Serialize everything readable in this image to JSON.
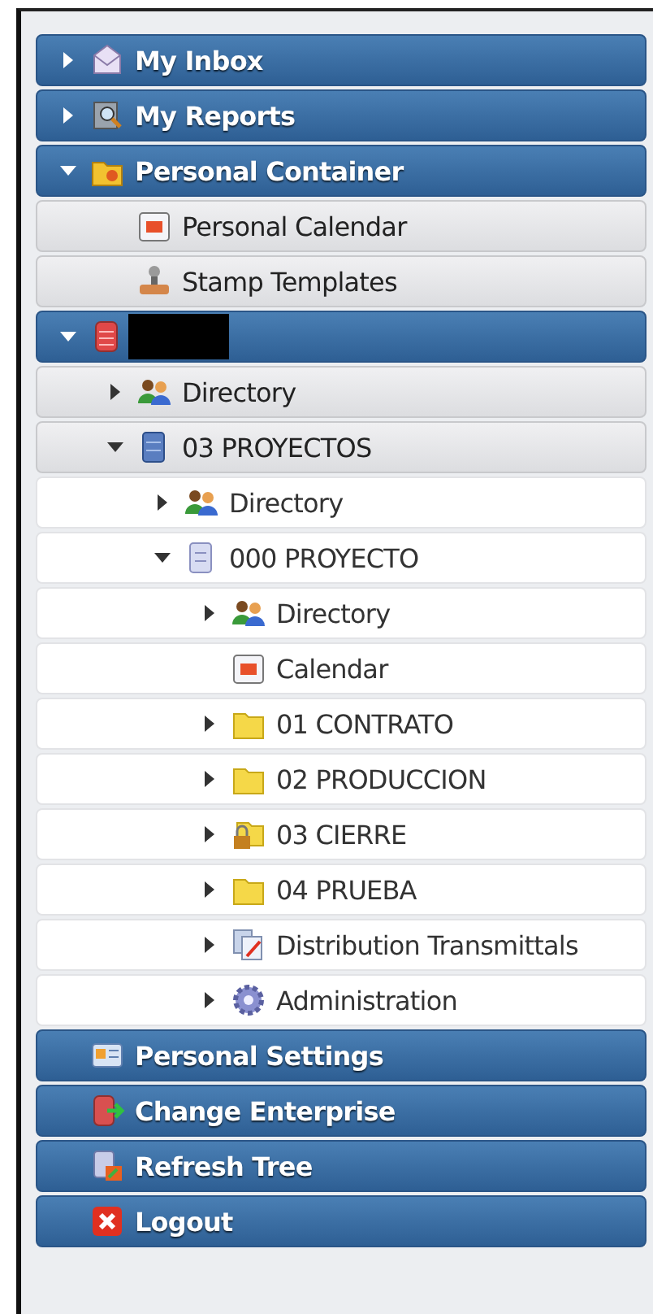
{
  "tree": [
    {
      "label": "My Inbox",
      "kind": "inbox",
      "expanded": false
    },
    {
      "label": "My Reports",
      "kind": "reports",
      "expanded": false
    },
    {
      "label": "Personal Container",
      "kind": "container",
      "expanded": true,
      "children": [
        {
          "label": "Personal Calendar",
          "kind": "calendar"
        },
        {
          "label": "Stamp Templates",
          "kind": "stamp"
        }
      ]
    },
    {
      "redacted": true,
      "kind": "enterprise",
      "expanded": true,
      "children": [
        {
          "label": "Directory",
          "kind": "directory",
          "expanded": false
        },
        {
          "label": "03 PROYECTOS",
          "kind": "cabinet",
          "expanded": true,
          "children": [
            {
              "label": "Directory",
              "kind": "directory",
              "expanded": false
            },
            {
              "label": "000 PROYECTO",
              "kind": "project",
              "expanded": true,
              "children": [
                {
                  "label": "Directory",
                  "kind": "directory",
                  "expanded": false
                },
                {
                  "label": "Calendar",
                  "kind": "calendar"
                },
                {
                  "label": "01 CONTRATO",
                  "kind": "folder",
                  "expanded": false
                },
                {
                  "label": "02 PRODUCCION",
                  "kind": "folder",
                  "expanded": false
                },
                {
                  "label": "03 CIERRE",
                  "kind": "locked-folder",
                  "expanded": false
                },
                {
                  "label": "04 PRUEBA",
                  "kind": "folder",
                  "expanded": false
                },
                {
                  "label": "Distribution Transmittals",
                  "kind": "transmittals",
                  "expanded": false
                },
                {
                  "label": "Administration",
                  "kind": "admin",
                  "expanded": false
                }
              ]
            }
          ]
        }
      ]
    },
    {
      "label": "Personal Settings",
      "kind": "settings"
    },
    {
      "label": "Change Enterprise",
      "kind": "change"
    },
    {
      "label": "Refresh Tree",
      "kind": "refresh"
    },
    {
      "label": "Logout",
      "kind": "logout"
    }
  ]
}
